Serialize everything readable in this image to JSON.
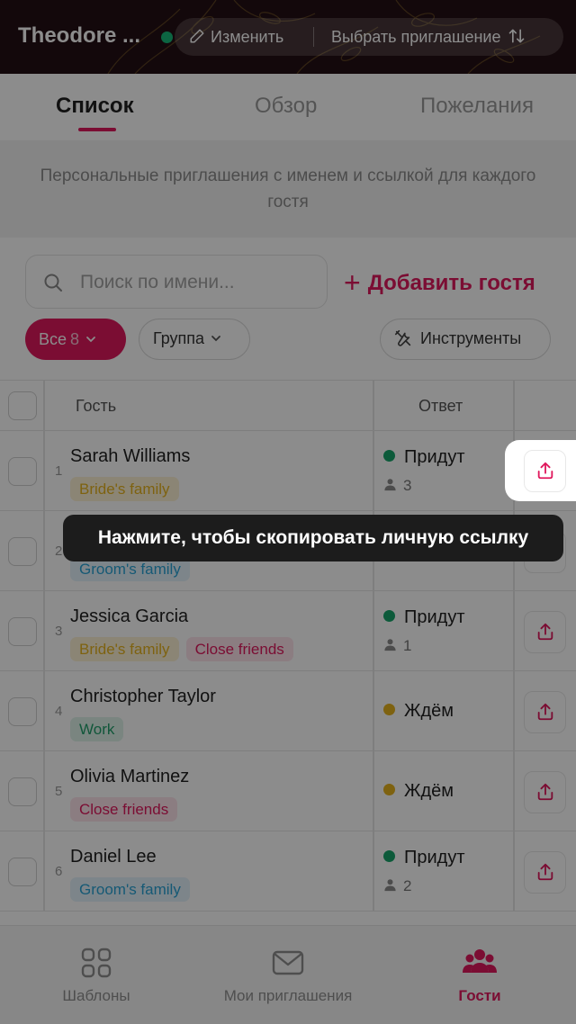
{
  "header": {
    "event_title": "Theodore ...",
    "edit_label": "Изменить",
    "choose_invite_label": "Выбрать приглашение"
  },
  "tabs": [
    "Список",
    "Обзор",
    "Пожелания"
  ],
  "info_text": "Персональные приглашения с именем и ссылкой для каждого гостя",
  "search": {
    "placeholder": "Поиск по имени..."
  },
  "add_guest_label": "Добавить гостя",
  "filters": {
    "all_label": "Все",
    "all_count": "8",
    "group_label": "Группа",
    "tools_label": "Инструменты"
  },
  "table": {
    "headers": {
      "guest": "Гость",
      "answer": "Ответ"
    },
    "rows": [
      {
        "num": "1",
        "name": "Sarah Williams",
        "tags": [
          "Bride's family"
        ],
        "status": "Придут",
        "persons": "3"
      },
      {
        "num": "2",
        "name": "",
        "tags": [
          "Groom's family"
        ],
        "status": "",
        "persons": ""
      },
      {
        "num": "3",
        "name": "Jessica Garcia",
        "tags": [
          "Bride's family",
          "Close friends"
        ],
        "status": "Придут",
        "persons": "1"
      },
      {
        "num": "4",
        "name": "Christopher Taylor",
        "tags": [
          "Work"
        ],
        "status": "Ждём",
        "persons": ""
      },
      {
        "num": "5",
        "name": "Olivia Martinez",
        "tags": [
          "Close friends"
        ],
        "status": "Ждём",
        "persons": ""
      },
      {
        "num": "6",
        "name": "Daniel Lee",
        "tags": [
          "Groom's family"
        ],
        "status": "Придут",
        "persons": "2"
      }
    ]
  },
  "tooltip": "Нажмите, чтобы скопировать личную ссылку",
  "bottom_nav": [
    {
      "label": "Шаблоны",
      "icon": "grid-icon"
    },
    {
      "label": "Мои приглашения",
      "icon": "mail-icon"
    },
    {
      "label": "Гости",
      "icon": "users-icon"
    }
  ],
  "colors": {
    "accent": "#e0195d",
    "going": "#17a56b",
    "waiting": "#e6b31e",
    "tag_bride": "#e6b31e",
    "tag_groom": "#29a3d6",
    "tag_close": "#e0195d",
    "tag_work": "#1f9e6a"
  }
}
